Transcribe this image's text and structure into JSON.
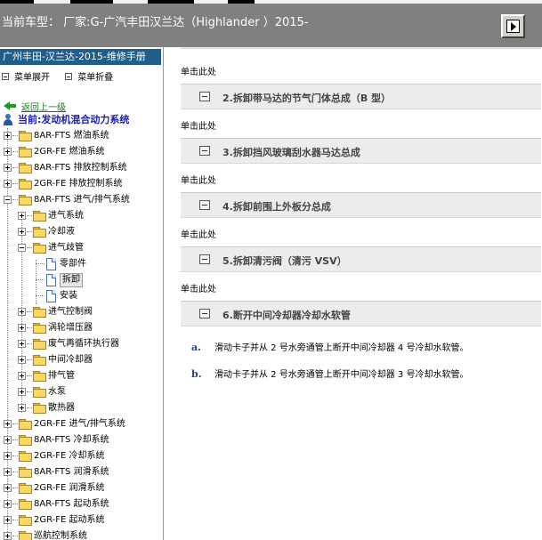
{
  "header": {
    "title": "当前车型： 厂家:G-广汽丰田汉兰达（Highlander ）2015-"
  },
  "sidebar": {
    "manual_title": "广州丰田-汉兰达-2015-维修手册",
    "expand_all": "菜单展开",
    "collapse_all": "菜单折叠",
    "back_link": "返回上一级",
    "current_system": "当前:发动机混合动力系统",
    "tree": [
      {
        "label": "8AR-FTS 燃油系统",
        "level": 0,
        "type": "folder",
        "expander": "plus"
      },
      {
        "label": "2GR-FE 燃油系统",
        "level": 0,
        "type": "folder",
        "expander": "plus"
      },
      {
        "label": "8AR-FTS 排放控制系统",
        "level": 0,
        "type": "folder",
        "expander": "plus"
      },
      {
        "label": "2GR-FE 排放控制系统",
        "level": 0,
        "type": "folder",
        "expander": "plus"
      },
      {
        "label": "8AR-FTS 进气/排气系统",
        "level": 0,
        "type": "folder",
        "expander": "minus"
      },
      {
        "label": "进气系统",
        "level": 1,
        "type": "folder",
        "expander": "plus"
      },
      {
        "label": "冷却液",
        "level": 1,
        "type": "folder",
        "expander": "plus"
      },
      {
        "label": "进气歧管",
        "level": 1,
        "type": "folder",
        "expander": "minus"
      },
      {
        "label": "零部件",
        "level": 2,
        "type": "doc",
        "expander": "none"
      },
      {
        "label": "拆卸",
        "level": 2,
        "type": "doc",
        "expander": "none",
        "selected": true
      },
      {
        "label": "安装",
        "level": 2,
        "type": "doc",
        "expander": "none"
      },
      {
        "label": "进气控制阀",
        "level": 1,
        "type": "folder",
        "expander": "plus"
      },
      {
        "label": "涡轮增压器",
        "level": 1,
        "type": "folder",
        "expander": "plus"
      },
      {
        "label": "废气再循环执行器",
        "level": 1,
        "type": "folder",
        "expander": "plus"
      },
      {
        "label": "中间冷却器",
        "level": 1,
        "type": "folder",
        "expander": "plus"
      },
      {
        "label": "排气管",
        "level": 1,
        "type": "folder",
        "expander": "plus"
      },
      {
        "label": "水泵",
        "level": 1,
        "type": "folder",
        "expander": "plus"
      },
      {
        "label": "散热器",
        "level": 1,
        "type": "folder",
        "expander": "plus"
      },
      {
        "label": "2GR-FE 进气/排气系统",
        "level": 0,
        "type": "folder",
        "expander": "plus"
      },
      {
        "label": "8AR-FTS 冷却系统",
        "level": 0,
        "type": "folder",
        "expander": "plus"
      },
      {
        "label": "2GR-FE 冷却系统",
        "level": 0,
        "type": "folder",
        "expander": "plus"
      },
      {
        "label": "8AR-FTS 润滑系统",
        "level": 0,
        "type": "folder",
        "expander": "plus"
      },
      {
        "label": "2GR-FE 润滑系统",
        "level": 0,
        "type": "folder",
        "expander": "plus"
      },
      {
        "label": "8AR-FTS 起动系统",
        "level": 0,
        "type": "folder",
        "expander": "plus"
      },
      {
        "label": "2GR-FE 起动系统",
        "level": 0,
        "type": "folder",
        "expander": "plus"
      },
      {
        "label": "巡航控制系统",
        "level": 0,
        "type": "folder",
        "expander": "plus"
      }
    ]
  },
  "content": {
    "click_here": "单击此处",
    "sections": [
      {
        "title": "2.拆卸带马达的节气门体总成（B 型）"
      },
      {
        "title": "3.拆卸挡风玻璃刮水器马达总成"
      },
      {
        "title": "4.拆卸前围上外板分总成"
      },
      {
        "title": "5.拆卸清污阀（清污 VSV）"
      },
      {
        "title": "6.断开中间冷却器冷却水软管"
      }
    ],
    "steps": [
      {
        "letter": "a.",
        "text": "滑动卡子并从 2 号水旁通管上断开中间冷却器 4 号冷却水软管。"
      },
      {
        "letter": "b.",
        "text": "滑动卡子并从 2 号水旁通管上断开中间冷却器 3 号冷却水软管。"
      }
    ]
  }
}
